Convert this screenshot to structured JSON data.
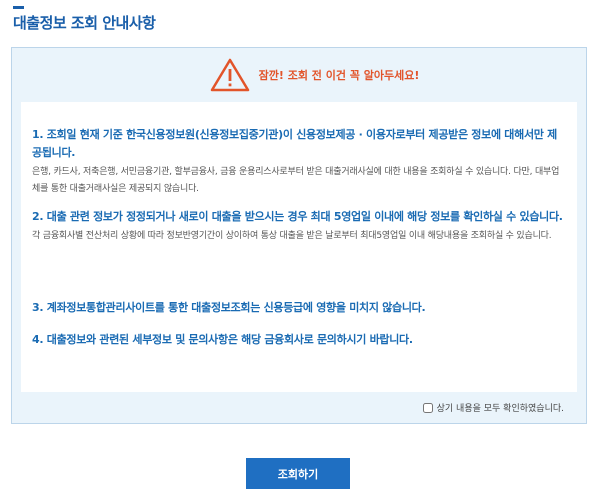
{
  "page": {
    "title": "대출정보 조회 안내사항"
  },
  "notice": {
    "warning_icon": "warning-triangle-icon",
    "warning_text": "잠깐! 조회 전 이건 꼭 알아두세요!",
    "items": [
      {
        "head": "1. 조회일 현재 기준 한국신용정보원(신용정보집중기관)이 신용정보제공 · 이용자로부터 제공받은 정보에 대해서만 제공됩니다.",
        "desc": "은행, 카드사, 저축은행, 서민금융기관, 할부금융사, 금융 운용리스사로부터 받은 대출거래사실에 대한 내용을 조회하실 수 있습니다. 다만, 대부업체를 통한 대출거래사실은 제공되지 않습니다."
      },
      {
        "head": "2. 대출 관련 정보가 정정되거나 새로이 대출을 받으시는 경우 최대 5영업일 이내에 해당 정보를 확인하실 수 있습니다.",
        "desc": "각 금융회사별 전산처리 상황에 따라 정보반영기간이 상이하여 통상 대출을 받은 날로부터 최대5영업일 이내 해당내용을 조회하실 수 있습니다."
      },
      {
        "head": "3. 계좌정보통합관리사이트를 통한 대출정보조회는 신용등급에 영향을 미치지 않습니다.",
        "desc": ""
      },
      {
        "head": "4. 대출정보와 관련된 세부정보 및 문의사항은 해당 금융회사로 문의하시기 바랍니다.",
        "desc": ""
      }
    ],
    "confirm_label": "상기 내용을 모두 확인하였습니다."
  },
  "actions": {
    "submit_label": "조회하기"
  },
  "colors": {
    "accent": "#1a5faa",
    "warning": "#e2542a",
    "button": "#1f6fc2"
  }
}
